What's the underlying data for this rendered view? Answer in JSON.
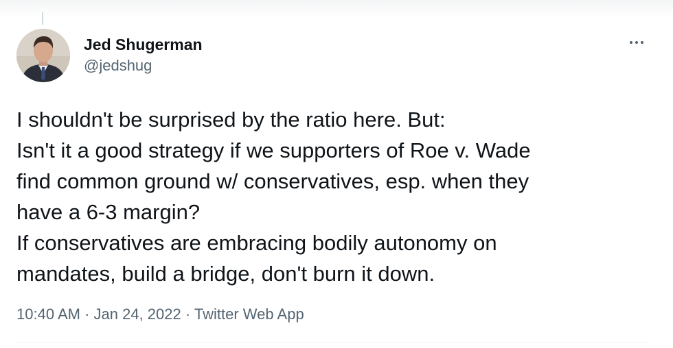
{
  "tweet": {
    "author": {
      "display_name": "Jed Shugerman",
      "handle": "@jedshug"
    },
    "more_icon": "ellipsis-icon",
    "text_lines": [
      "I shouldn't be surprised by the ratio here. But:",
      "Isn't it a good strategy if we supporters of Roe v. Wade",
      "find common ground w/ conservatives, esp. when they",
      "have a 6-3 margin?",
      "If conservatives are embracing bodily autonomy on",
      "mandates, build a bridge, don't burn it down."
    ],
    "time": "10:40 AM",
    "date": "Jan 24, 2022",
    "source": "Twitter Web App",
    "separator": " · "
  }
}
